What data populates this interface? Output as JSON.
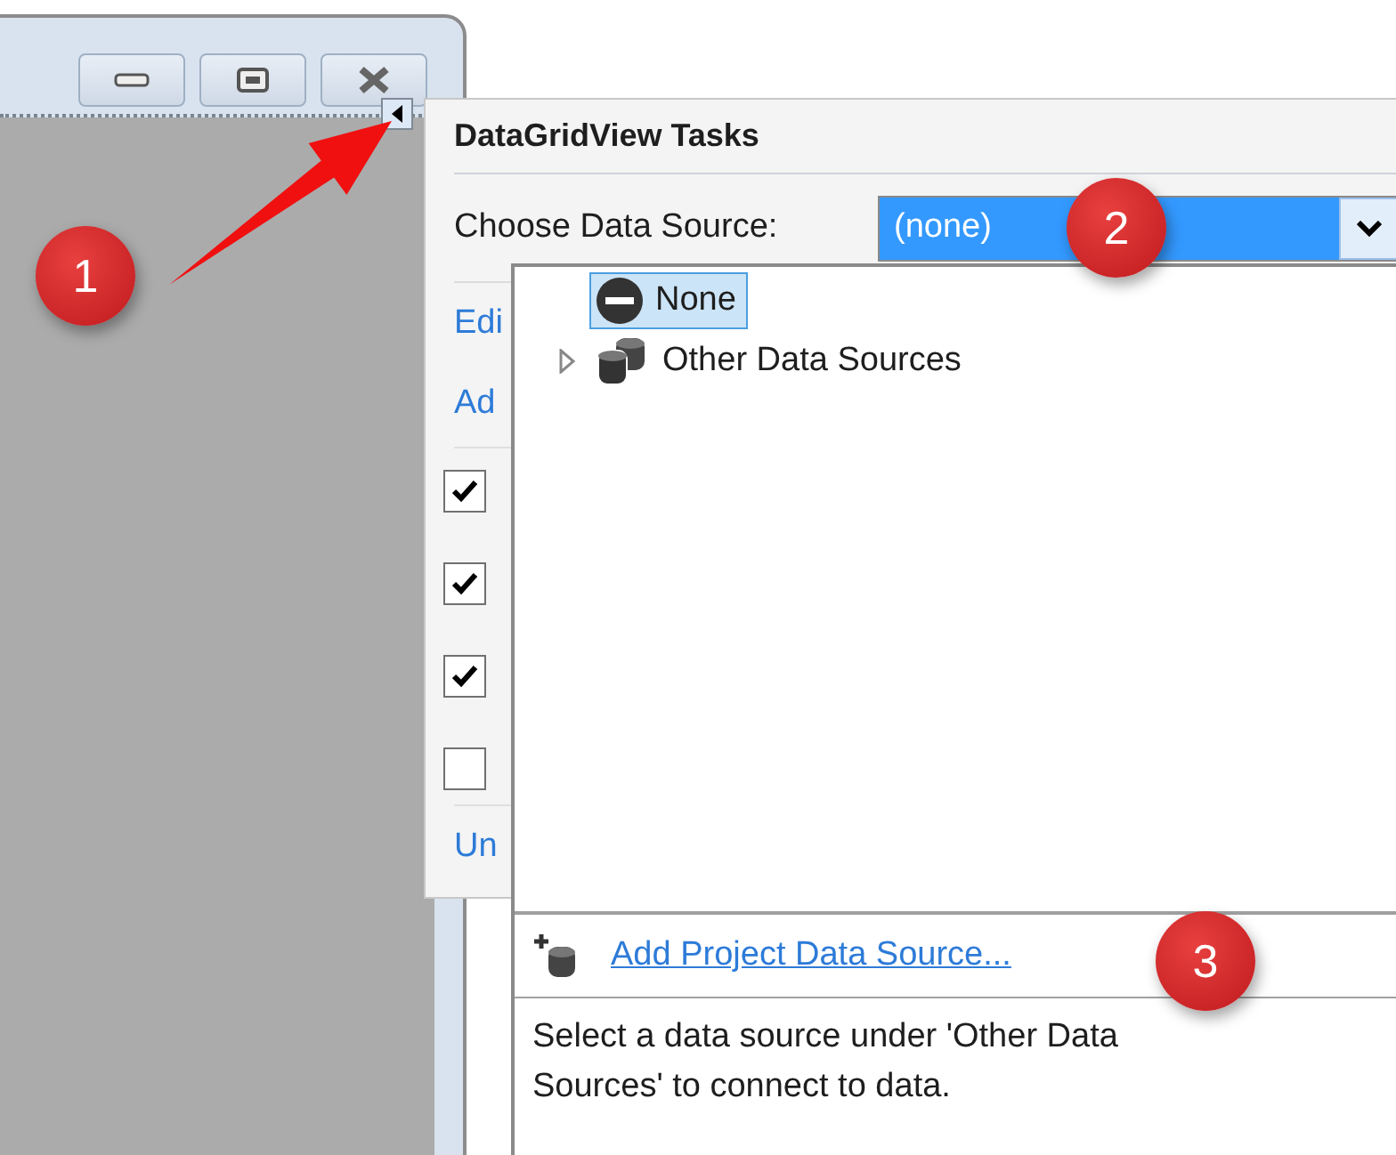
{
  "tasks_panel": {
    "title": "DataGridView Tasks",
    "data_source_label": "Choose Data Source:",
    "data_source_value": "(none)",
    "links_top": [
      "Edi",
      "Ad"
    ],
    "checkboxes": [
      {
        "checked": true
      },
      {
        "checked": true
      },
      {
        "checked": true
      },
      {
        "checked": false
      }
    ],
    "links_bottom": [
      "Un"
    ]
  },
  "dropdown": {
    "tree": [
      {
        "kind": "none",
        "label": "None",
        "selected": true
      },
      {
        "kind": "group",
        "label": "Other Data Sources",
        "selected": false,
        "expanded": false
      }
    ],
    "add_link": "Add Project Data Source...",
    "description": "Select a data source under 'Other Data Sources' to connect to data."
  },
  "callouts": [
    "1",
    "2",
    "3"
  ]
}
